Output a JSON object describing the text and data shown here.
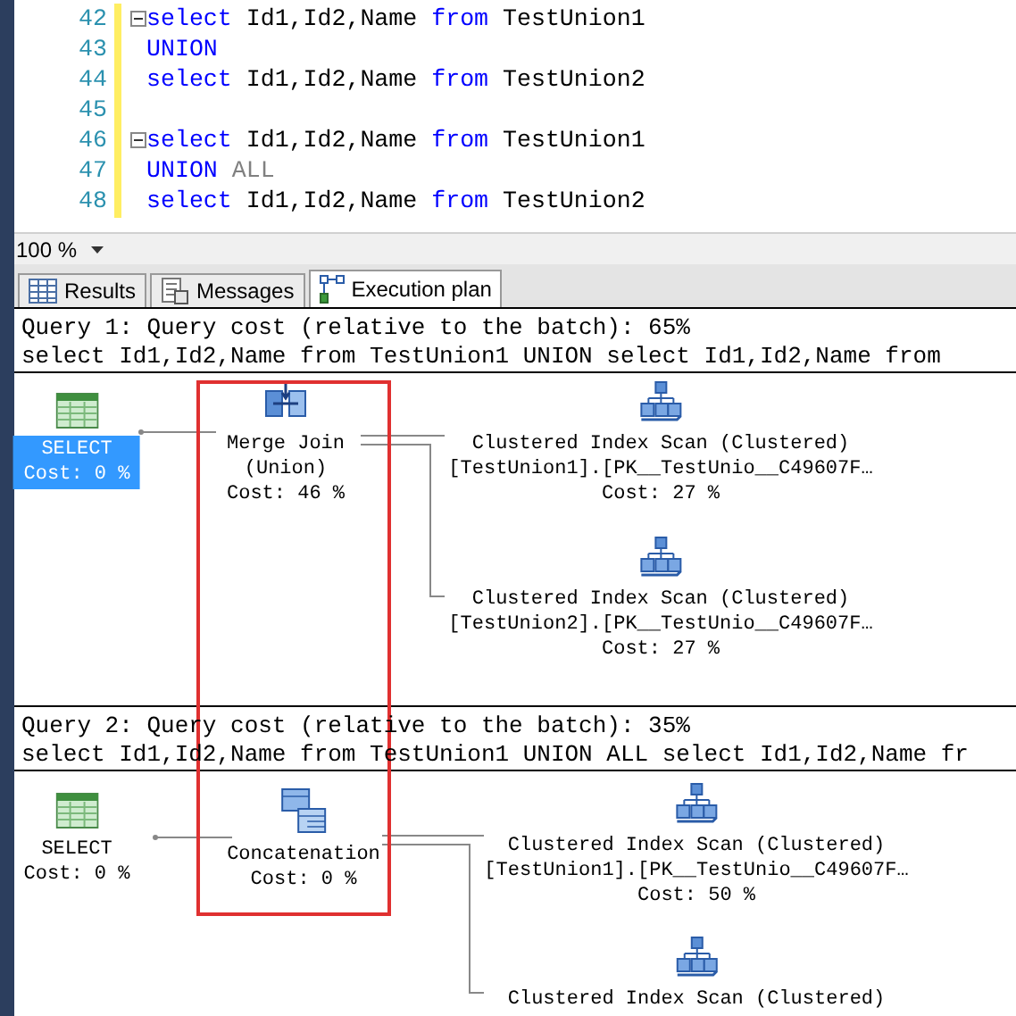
{
  "editor": {
    "lines": [
      {
        "number": "42",
        "fold": true,
        "tokens": [
          {
            "kind": "keyword",
            "text": "select"
          },
          {
            "kind": "plain",
            "text": " Id1,Id2,Name "
          },
          {
            "kind": "keyword",
            "text": "from"
          },
          {
            "kind": "plain",
            "text": " TestUnion1"
          }
        ]
      },
      {
        "number": "43",
        "fold": false,
        "tokens": [
          {
            "kind": "keyword",
            "text": "UNION"
          }
        ]
      },
      {
        "number": "44",
        "fold": false,
        "tokens": [
          {
            "kind": "keyword",
            "text": "select"
          },
          {
            "kind": "plain",
            "text": " Id1,Id2,Name "
          },
          {
            "kind": "keyword",
            "text": "from"
          },
          {
            "kind": "plain",
            "text": " TestUnion2"
          }
        ]
      },
      {
        "number": "45",
        "fold": false
      },
      {
        "number": "46",
        "fold": true,
        "tokens": [
          {
            "kind": "keyword",
            "text": "select"
          },
          {
            "kind": "plain",
            "text": " Id1,Id2,Name "
          },
          {
            "kind": "keyword",
            "text": "from"
          },
          {
            "kind": "plain",
            "text": " TestUnion1"
          }
        ]
      },
      {
        "number": "47",
        "fold": false,
        "tokens": [
          {
            "kind": "keyword",
            "text": "UNION"
          },
          {
            "kind": "operator",
            "text": "ALL"
          }
        ]
      },
      {
        "number": "48",
        "fold": false,
        "tokens": [
          {
            "kind": "keyword",
            "text": "select"
          },
          {
            "kind": "plain",
            "text": " Id1,Id2,Name "
          },
          {
            "kind": "keyword",
            "text": "from"
          },
          {
            "kind": "plain",
            "text": " TestUnion2"
          }
        ]
      }
    ]
  },
  "zoom": {
    "value": "100 %"
  },
  "tabs": [
    {
      "label": "Results",
      "kind": "grid",
      "selected": false
    },
    {
      "label": "Messages",
      "kind": "messages",
      "selected": false
    },
    {
      "label": "Execution plan",
      "kind": "plan",
      "selected": true
    }
  ],
  "queries": [
    {
      "header": "Query 1: Query cost (relative to the batch): 65%",
      "sql": "select Id1,Id2,Name from TestUnion1 UNION select Id1,Id2,Name from",
      "nodes": [
        {
          "kind": "select",
          "lines": [
            "SELECT"
          ],
          "cost": "Cost: 0 %",
          "selected": true
        },
        {
          "kind": "merge_join",
          "lines": [
            "Merge Join",
            "(Union)"
          ],
          "cost": "Cost: 46 %",
          "selected": false
        },
        {
          "kind": "index_scan",
          "lines": [
            "Clustered Index Scan (Clustered)",
            "[TestUnion1].[PK__TestUnio__C49607F…"
          ],
          "cost": "Cost: 27 %",
          "selected": false
        },
        {
          "kind": "index_scan",
          "lines": [
            "Clustered Index Scan (Clustered)",
            "[TestUnion2].[PK__TestUnio__C49607F…"
          ],
          "cost": "Cost: 27 %",
          "selected": false
        }
      ]
    },
    {
      "header": "Query 2: Query cost (relative to the batch): 35%",
      "sql": "select Id1,Id2,Name from TestUnion1 UNION ALL select Id1,Id2,Name fr",
      "nodes": [
        {
          "kind": "select",
          "lines": [
            "SELECT"
          ],
          "cost": "Cost: 0 %",
          "selected": false
        },
        {
          "kind": "concatenation",
          "lines": [
            "Concatenation"
          ],
          "cost": "Cost: 0 %",
          "selected": false
        },
        {
          "kind": "index_scan",
          "lines": [
            "Clustered Index Scan (Clustered)",
            "[TestUnion1].[PK__TestUnio__C49607F…"
          ],
          "cost": "Cost: 50 %",
          "selected": false
        },
        {
          "kind": "index_scan",
          "lines": [
            "Clustered Index Scan (Clustered)"
          ],
          "selected": false
        }
      ]
    }
  ]
}
